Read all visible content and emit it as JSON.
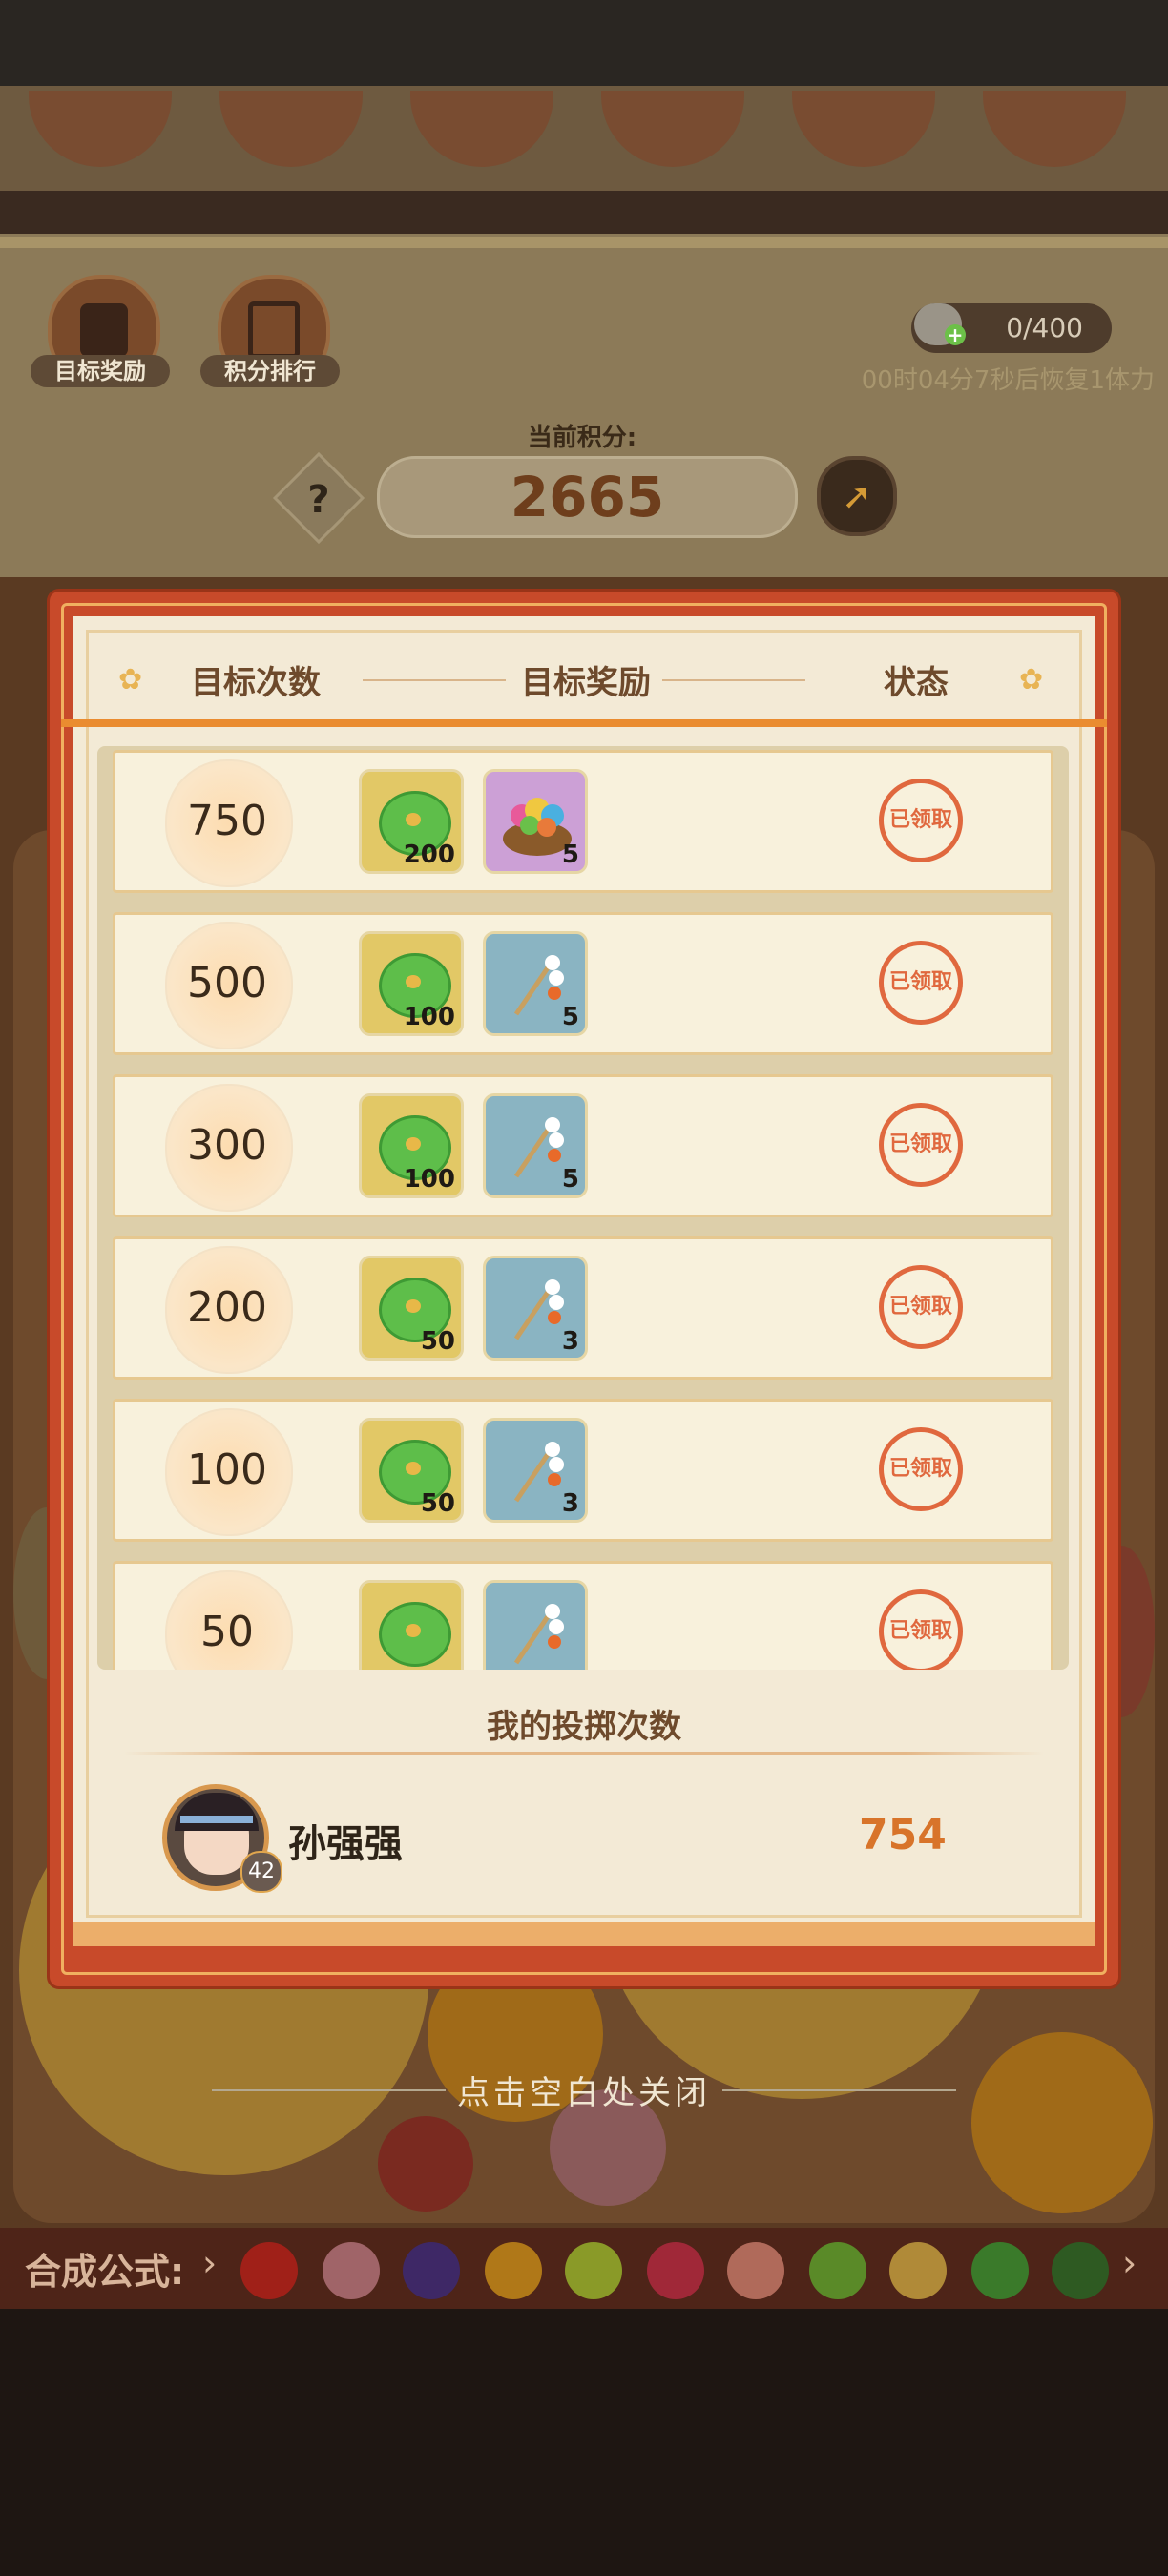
{
  "hud": {
    "target_reward_label": "目标奖励",
    "ranking_label": "积分排行",
    "stamina": "0/400",
    "recover_text": "00时04分7秒后恢复1体力",
    "current_score_label": "当前积分:",
    "current_score": "2665",
    "help_label": "?"
  },
  "modal": {
    "headers": {
      "count": "目标次数",
      "reward": "目标奖励",
      "status": "状态"
    },
    "rows": [
      {
        "count": "750",
        "rewards": [
          {
            "type": "coin-icon",
            "qty": "200"
          },
          {
            "type": "basket-icon",
            "qty": "5"
          }
        ],
        "status": "已领取"
      },
      {
        "count": "500",
        "rewards": [
          {
            "type": "coin-icon",
            "qty": "100"
          },
          {
            "type": "stick-icon",
            "qty": "5"
          }
        ],
        "status": "已领取"
      },
      {
        "count": "300",
        "rewards": [
          {
            "type": "coin-icon",
            "qty": "100"
          },
          {
            "type": "stick-icon",
            "qty": "5"
          }
        ],
        "status": "已领取"
      },
      {
        "count": "200",
        "rewards": [
          {
            "type": "coin-icon",
            "qty": "50"
          },
          {
            "type": "stick-icon",
            "qty": "3"
          }
        ],
        "status": "已领取"
      },
      {
        "count": "100",
        "rewards": [
          {
            "type": "coin-icon",
            "qty": "50"
          },
          {
            "type": "stick-icon",
            "qty": "3"
          }
        ],
        "status": "已领取"
      },
      {
        "count": "50",
        "rewards": [
          {
            "type": "coin-icon",
            "qty": ""
          },
          {
            "type": "stick-icon",
            "qty": ""
          }
        ],
        "status": "已领取"
      }
    ],
    "my_throws_title": "我的投掷次数",
    "player": {
      "name": "孙强强",
      "level": "42",
      "throw_count": "754"
    }
  },
  "close_hint": "点击空白处关闭",
  "formula": {
    "label": "合成公式:"
  },
  "colors": {
    "modal_frame": "#c84a2a",
    "modal_body": "#f3ead6",
    "stamp": "#e0683e",
    "count_accent": "#d8742a"
  }
}
